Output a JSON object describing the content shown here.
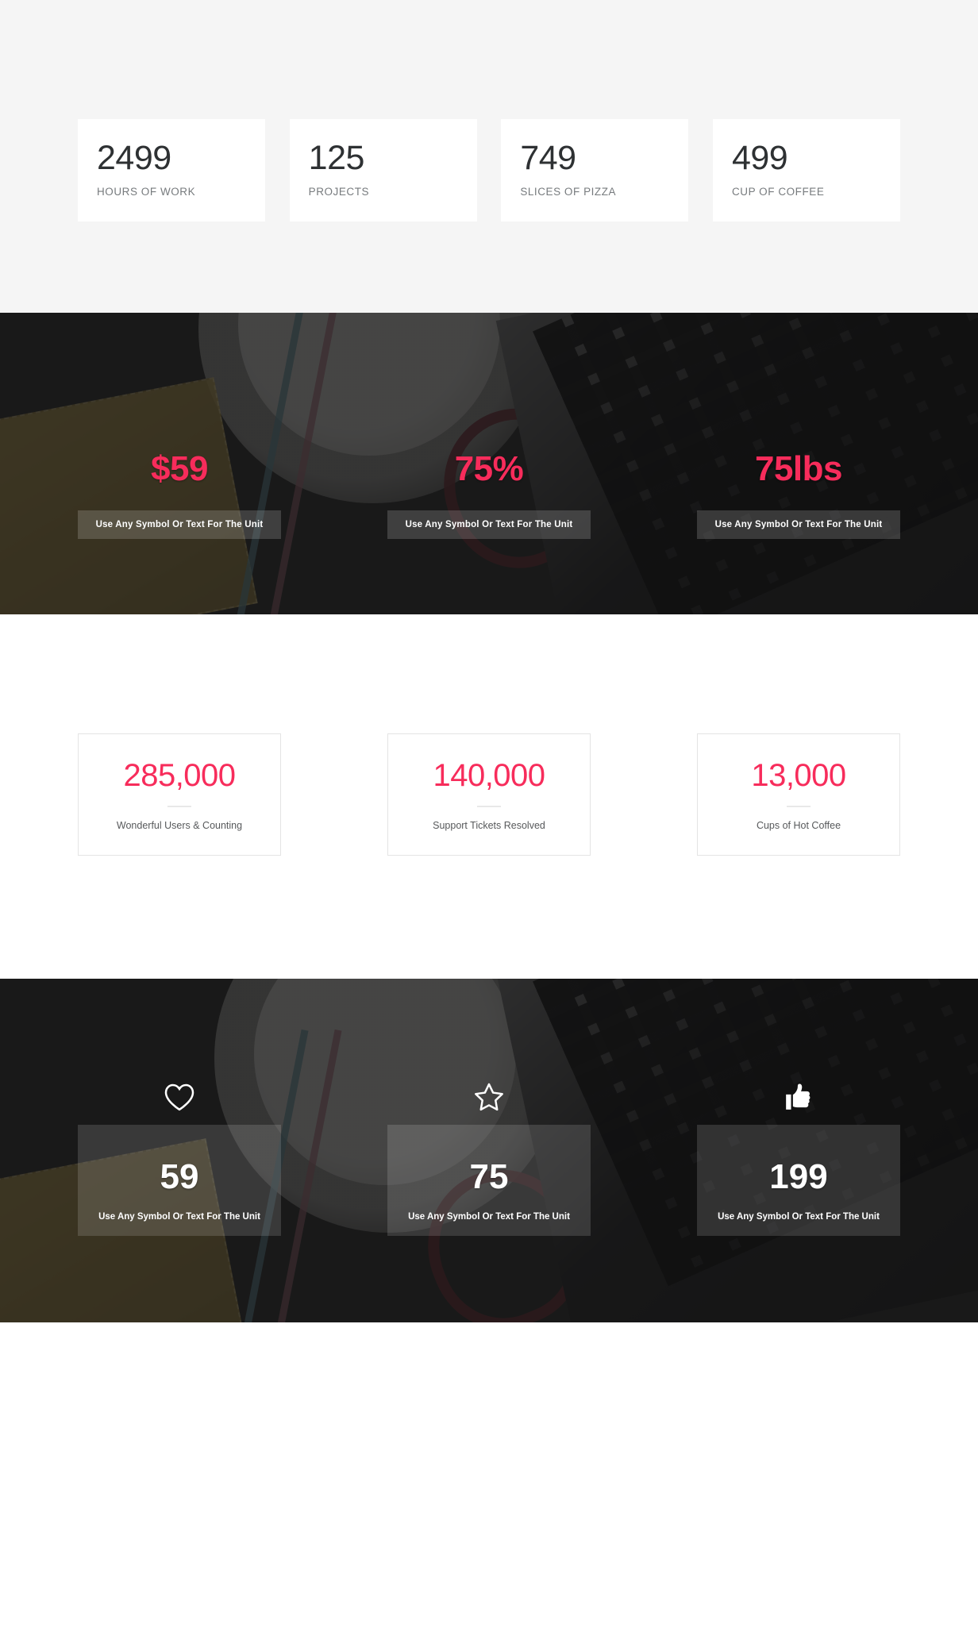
{
  "theme": {
    "accent_pink": "#F72C5B",
    "dark_text": "#2E3133",
    "muted_text": "#777B7E",
    "light_bg": "#F5F5F5",
    "white": "#FFFFFF"
  },
  "section_plain_counters": {
    "items": [
      {
        "number": "2499",
        "label": "HOURS OF WORK"
      },
      {
        "number": "125",
        "label": "PROJECTS"
      },
      {
        "number": "749",
        "label": "SLICES OF PIZZA"
      },
      {
        "number": "499",
        "label": "CUP OF COFFEE"
      }
    ]
  },
  "section_photo_pink": {
    "items": [
      {
        "number": "$59",
        "unit": "Use Any Symbol Or Text For The Unit"
      },
      {
        "number": "75%",
        "unit": "Use Any Symbol Or Text For The Unit"
      },
      {
        "number": "75lbs",
        "unit": "Use Any Symbol Or Text For The Unit"
      }
    ]
  },
  "section_bordered_counters": {
    "items": [
      {
        "number": "285,000",
        "label": "Wonderful Users & Counting"
      },
      {
        "number": "140,000",
        "label": "Support Tickets Resolved"
      },
      {
        "number": "13,000",
        "label": "Cups of Hot Coffee"
      }
    ]
  },
  "section_photo_icons": {
    "items": [
      {
        "icon": "heart-icon",
        "number": "59",
        "unit": "Use Any Symbol Or Text For The Unit"
      },
      {
        "icon": "star-icon",
        "number": "75",
        "unit": "Use Any Symbol Or Text For The Unit"
      },
      {
        "icon": "thumbs-up-icon",
        "number": "199",
        "unit": "Use Any Symbol Or Text For The Unit"
      }
    ]
  }
}
